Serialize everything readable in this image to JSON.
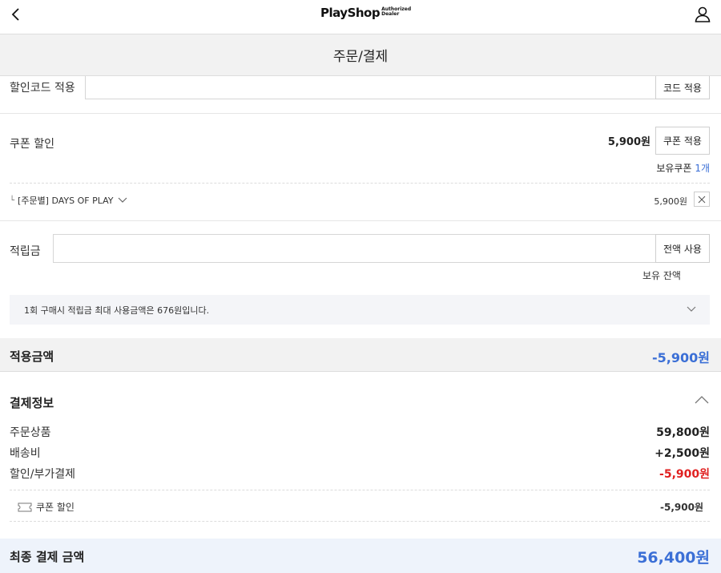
{
  "header": {
    "logo_main": "PlayShop",
    "logo_sub_1": "Authorized",
    "logo_sub_2": "Dealer",
    "title": "주문/결제"
  },
  "discount_code": {
    "label": "할인코드 적용",
    "value": "",
    "button": "코드 적용"
  },
  "coupon": {
    "label": "쿠폰 할인",
    "amount": "5,900원",
    "button": "쿠폰 적용",
    "owned_label": "보유쿠폰",
    "owned_count": "1개",
    "applied_name": "[주문별] DAYS OF PLAY",
    "applied_amount": "5,900원"
  },
  "points": {
    "label": "적립금",
    "value": "",
    "button": "전액 사용",
    "balance_label": "보유 잔액",
    "notice": "1회 구매시 적립금 최대 사용금액은 676원입니다."
  },
  "applied_total": {
    "label": "적용금액",
    "amount": "-5,900원"
  },
  "payment_info": {
    "title": "결제정보",
    "rows": [
      {
        "label": "주문상품",
        "amount": "59,800원"
      },
      {
        "label": "배송비",
        "amount": "+2,500원"
      },
      {
        "label": "할인/부가결제",
        "amount": "-5,900원"
      }
    ],
    "sub_label": "쿠폰 할인",
    "sub_amount": "-5,900원"
  },
  "final": {
    "label": "최종 결제 금액",
    "amount": "56,400원"
  },
  "icons": {
    "back": "chevron-left-icon",
    "user": "user-icon",
    "remove": "close-icon",
    "expand": "chevron-down-icon",
    "collapse": "chevron-up-icon",
    "coupon": "ticket-icon"
  },
  "colors": {
    "accent_blue": "#3b6fd6",
    "discount_red": "#e02020",
    "final_bar": "#eef3fb"
  }
}
